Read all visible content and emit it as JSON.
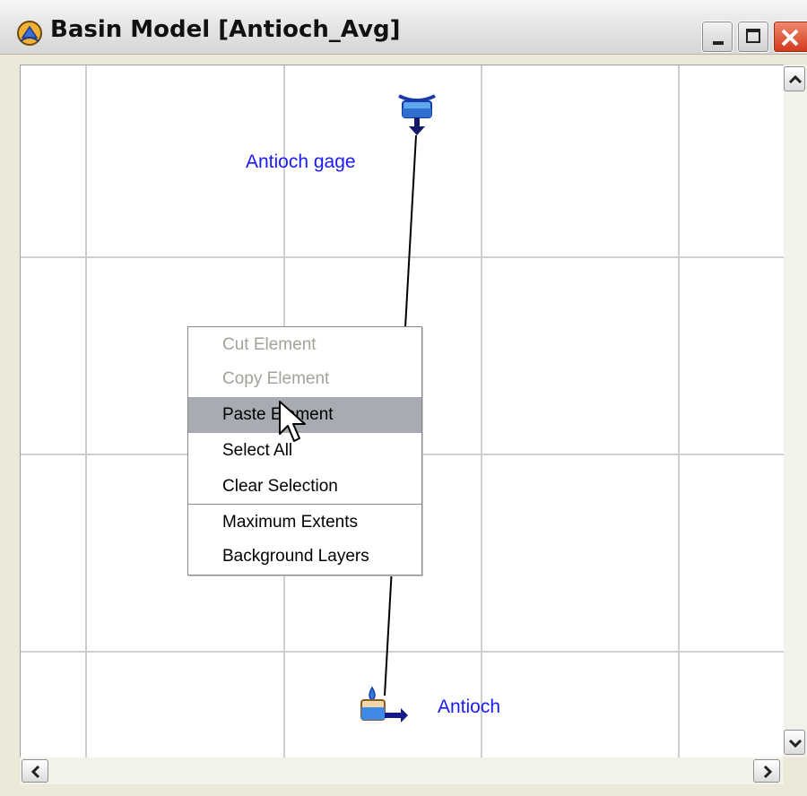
{
  "window": {
    "title": "Basin Model [Antioch_Avg]",
    "title_icon": "hec-hms-app-icon"
  },
  "canvas": {
    "nodes": {
      "gage_label": "Antioch gage",
      "sink_label": "Antioch"
    },
    "colors": {
      "grid": "#cfcfcf",
      "label": "#1a1aff",
      "link": "#000000"
    }
  },
  "context_menu": {
    "items": [
      {
        "label": "Cut Element",
        "enabled": false,
        "highlighted": false
      },
      {
        "label": "Copy Element",
        "enabled": false,
        "highlighted": false
      },
      {
        "label": "Paste Element",
        "enabled": true,
        "highlighted": true
      },
      {
        "label": "Select All",
        "enabled": true,
        "highlighted": false
      },
      {
        "label": "Clear Selection",
        "enabled": true,
        "highlighted": false
      },
      {
        "label": "Maximum Extents",
        "enabled": true,
        "highlighted": false
      },
      {
        "label": "Background Layers",
        "enabled": true,
        "highlighted": false
      }
    ],
    "highlight_color": "#a8abb2",
    "disabled_color": "#a3a39b"
  }
}
